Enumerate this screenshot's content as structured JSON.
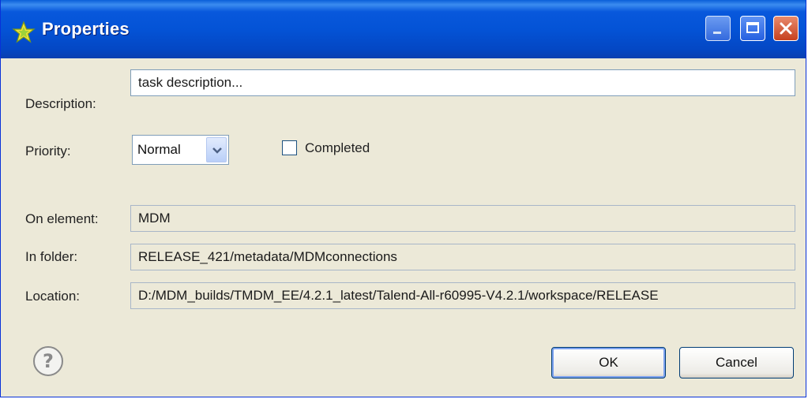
{
  "window": {
    "title": "Properties",
    "controls": {
      "minimize_icon": "minimize-icon",
      "maximize_icon": "maximize-icon",
      "close_icon": "close-icon"
    }
  },
  "form": {
    "description_label": "Description:",
    "description_value": "task description...",
    "priority_label": "Priority:",
    "priority_value": "Normal",
    "completed_label": "Completed",
    "completed_checked": false,
    "on_element_label": "On element:",
    "on_element_value": "MDM",
    "in_folder_label": "In folder:",
    "in_folder_value": "RELEASE_421/metadata/MDMconnections",
    "location_label": "Location:",
    "location_value": "D:/MDM_builds/TMDM_EE/4.2.1_latest/Talend-All-r60995-V4.2.1/workspace/RELEASE"
  },
  "buttons": {
    "ok_label": "OK",
    "cancel_label": "Cancel",
    "help_icon": "help-icon"
  },
  "colors": {
    "titlebar": "#0453d6",
    "dialog_bg": "#ece9d8",
    "close_button": "#c6401f"
  }
}
